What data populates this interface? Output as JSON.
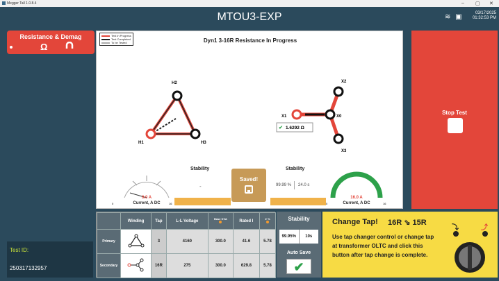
{
  "window": {
    "title": "Megger Tall 1.0.8.4",
    "min": "–",
    "max": "▢",
    "close": "✕"
  },
  "header": {
    "title": "MTOU3-EXP",
    "date": "03/17/2025",
    "time": "01:32:53 PM"
  },
  "mode": {
    "label": "Resistance & Demag",
    "ohm": "Ω",
    "magnet": "⌂"
  },
  "test": {
    "id_label": "Test ID:",
    "id_value": "250317132957"
  },
  "legend": [
    {
      "label": "Test in Progress",
      "color": "#e3463a"
    },
    {
      "label": "Test Completed",
      "color": "#222222"
    },
    {
      "label": "To be Tested",
      "color": "#aaaaaa"
    }
  ],
  "diagram": {
    "title": "Dyn1 3-16R Resistance  In Progress",
    "primary_nodes": [
      "H1",
      "H2",
      "H3"
    ],
    "secondary_nodes": [
      "X0",
      "X1",
      "X2",
      "X3"
    ],
    "measurement": "1.6292 Ω"
  },
  "stability_left": {
    "label": "Stability",
    "value": "-"
  },
  "stability_right": {
    "label": "Stability",
    "percent": "99.99 %",
    "seconds": "24.0 s"
  },
  "saved": {
    "label": "Saved!"
  },
  "gauge_left": {
    "value": "0.0 A",
    "label": "Current, A DC",
    "min": "0",
    "max": "16",
    "fraction": 0.0
  },
  "gauge_right": {
    "value": "16.0 A",
    "label": "Current, A DC",
    "min": "0",
    "max": "16",
    "fraction": 1.0
  },
  "stop": {
    "label": "Stop Test"
  },
  "table": {
    "headers": [
      "Winding",
      "Tap",
      "L-L Voltage",
      "Base KVA",
      "Rated I",
      "Z %"
    ],
    "rows": [
      {
        "name": "Primary",
        "tap": "3",
        "voltage": "4160",
        "kva": "300.0",
        "rated": "41.6",
        "z": "5.78"
      },
      {
        "name": "Secondary",
        "tap": "16R",
        "voltage": "275",
        "kva": "300.0",
        "rated": "629.8",
        "z": "5.78"
      }
    ]
  },
  "stability_box": {
    "title": "Stability",
    "percent": "99.95%",
    "seconds": "10s",
    "auto_save": "Auto Save",
    "check": "✔"
  },
  "change_tap": {
    "title": "Change Tap!",
    "taps": "16R ⇘ 15R",
    "message": "Use tap changer control or change tap at transformer OLTC and click this button after tap change is complete."
  },
  "colors": {
    "accent_red": "#e3463a",
    "accent_yellow": "#f7db44",
    "bg": "#2b4a5c",
    "green": "#2da14a",
    "orange": "#f0b24a"
  }
}
